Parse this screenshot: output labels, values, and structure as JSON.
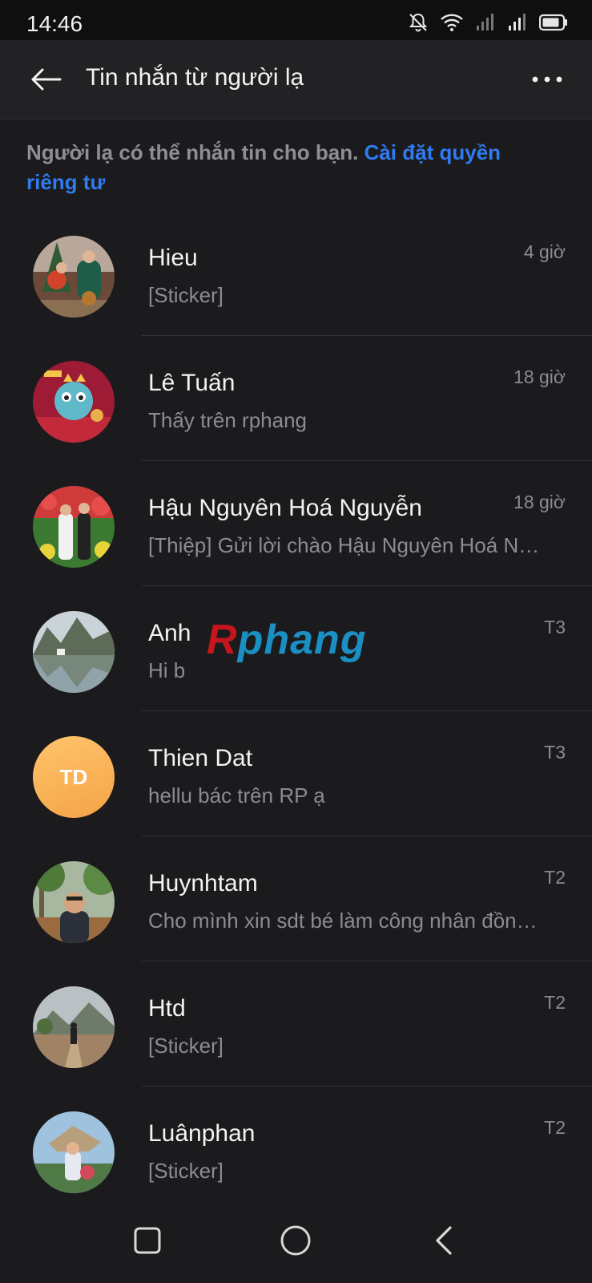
{
  "status": {
    "time": "14:46"
  },
  "header": {
    "title": "Tin nhắn từ người lạ"
  },
  "notice": {
    "text": "Người lạ có thể nhắn tin cho bạn. ",
    "link": "Cài đặt quyền riêng tư"
  },
  "watermark": {
    "r": "R",
    "rest": "phang"
  },
  "colors": {
    "accent": "#2f7bf0",
    "background": "#1b1b1d",
    "appbar": "#222224"
  },
  "conversations": [
    {
      "name": "Hieu",
      "preview": "[Sticker]",
      "time": "4 giờ",
      "avatar": "photo-family"
    },
    {
      "name": "Lê Tuấn",
      "preview": "Thấy trên rphang",
      "time": "18 giờ",
      "avatar": "photo-cartoon-dragon"
    },
    {
      "name": "Hậu Nguyên Hoá Nguyễn",
      "preview": "[Thiệp] Gửi lời chào Hậu Nguyên Hoá Nguyễn",
      "time": "18 giờ",
      "avatar": "photo-wedding"
    },
    {
      "name": "Anh",
      "preview": "Hi b",
      "time": "T3",
      "avatar": "photo-landscape"
    },
    {
      "name": "Thien Dat",
      "preview": "hellu bác trên RP ạ",
      "time": "T3",
      "avatar": "initials",
      "initials": "TD"
    },
    {
      "name": "Huynhtam",
      "preview": "Cho mình xin sdt bé làm công nhân đồng phục",
      "time": "T2",
      "avatar": "photo-man"
    },
    {
      "name": "Htd",
      "preview": "[Sticker]",
      "time": "T2",
      "avatar": "photo-road"
    },
    {
      "name": "Luânphan",
      "preview": "[Sticker]",
      "time": "T2",
      "avatar": "photo-child"
    }
  ]
}
